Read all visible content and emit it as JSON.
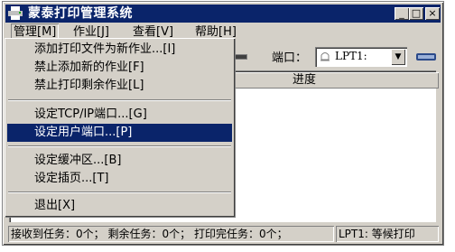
{
  "window": {
    "title": "蒙泰打印管理系统",
    "app_icon": "printer-app-icon",
    "controls": {
      "minimize": "_",
      "maximize": "□",
      "close": "×"
    }
  },
  "menubar": {
    "items": [
      {
        "label": "管理[M]"
      },
      {
        "label": "作业[J]"
      },
      {
        "label": "查看[V]"
      },
      {
        "label": "帮助[H]"
      }
    ]
  },
  "toolbar": {
    "port_label": "端口：",
    "port_value": "LPT1:",
    "port_icon": "port-icon"
  },
  "list": {
    "column_progress": "进度"
  },
  "manage_menu": {
    "items": [
      {
        "label": "添加打印文件为新作业...[I]"
      },
      {
        "label": "禁止添加新的作业[F]"
      },
      {
        "label": "禁止打印剩余作业[L]"
      },
      {
        "label": "设定TCP/IP端口...[G]"
      },
      {
        "label": "设定用户端口...[P]"
      },
      {
        "label": "设定缓冲区...[B]"
      },
      {
        "label": "设定插页...[T]"
      },
      {
        "label": "退出[X]"
      }
    ],
    "highlighted_index": 4
  },
  "statusbar": {
    "received": "接收到任务：0个；",
    "remaining": "剩余任务：0个；",
    "printed": "打印完任务：0个；",
    "port_status": "LPT1: 等候打印"
  },
  "colors": {
    "titlebar": "#0a246a",
    "face": "#d4d0c8",
    "highlight": "#0a246a"
  }
}
